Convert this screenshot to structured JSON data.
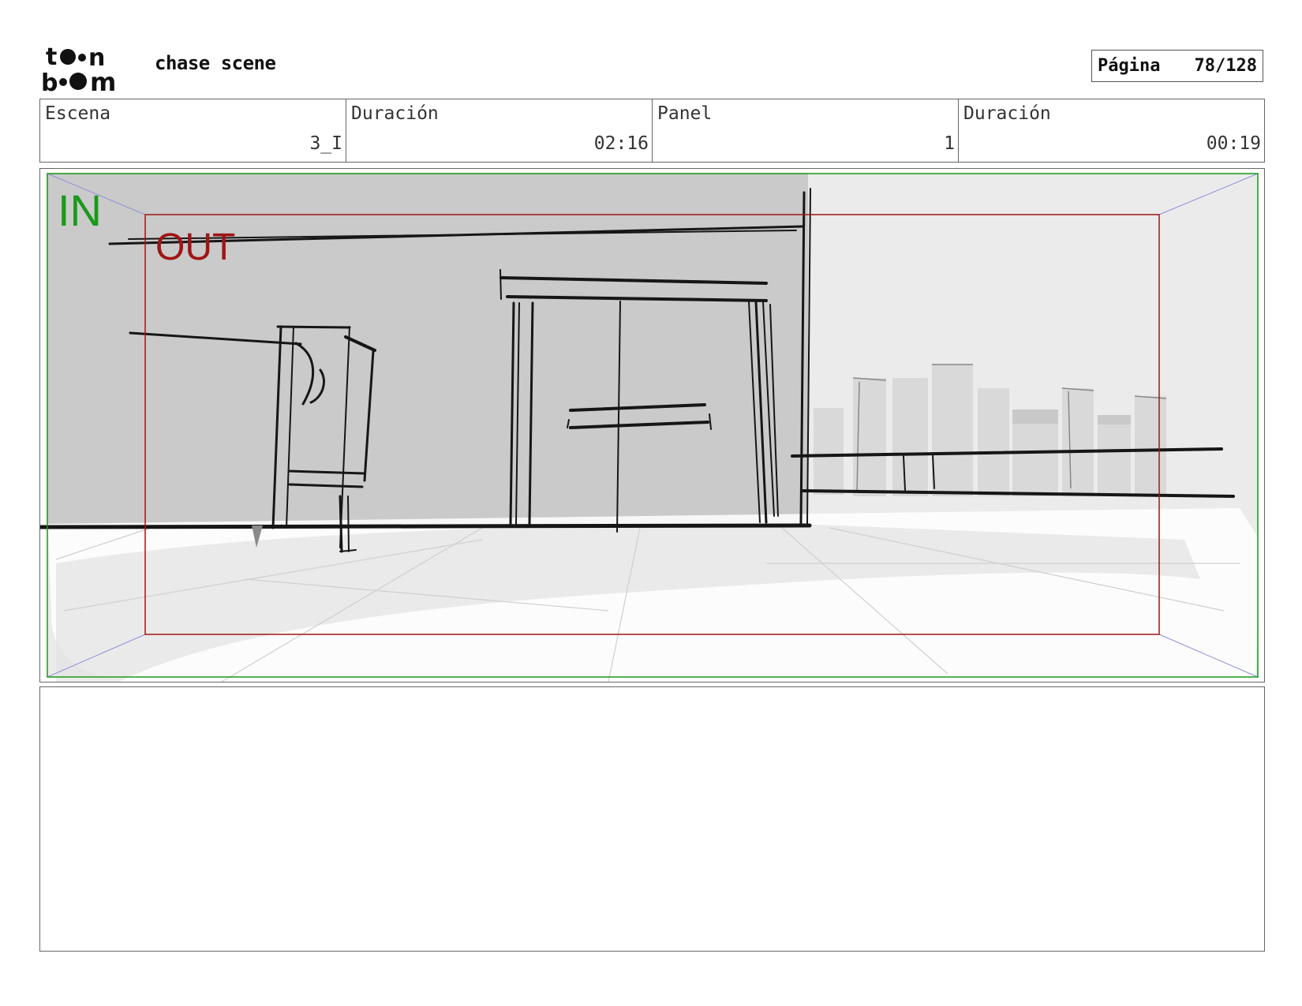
{
  "header": {
    "logo_text_top": "toon",
    "logo_text_bottom": "boom",
    "project_title": "chase scene",
    "page_label": "Página",
    "page_number": "78/128"
  },
  "info": {
    "scene_label": "Escena",
    "scene_value": "3_I",
    "scene_duration_label": "Duración",
    "scene_duration_value": "02:16",
    "panel_label": "Panel",
    "panel_value": "1",
    "panel_duration_label": "Duración",
    "panel_duration_value": "00:19"
  },
  "panel": {
    "in_label": "IN",
    "out_label": "OUT",
    "colors": {
      "in_frame": "#1a9a1a",
      "out_frame": "#a01515",
      "perspective": "#8f8fd8"
    }
  },
  "notes": {
    "text": ""
  }
}
